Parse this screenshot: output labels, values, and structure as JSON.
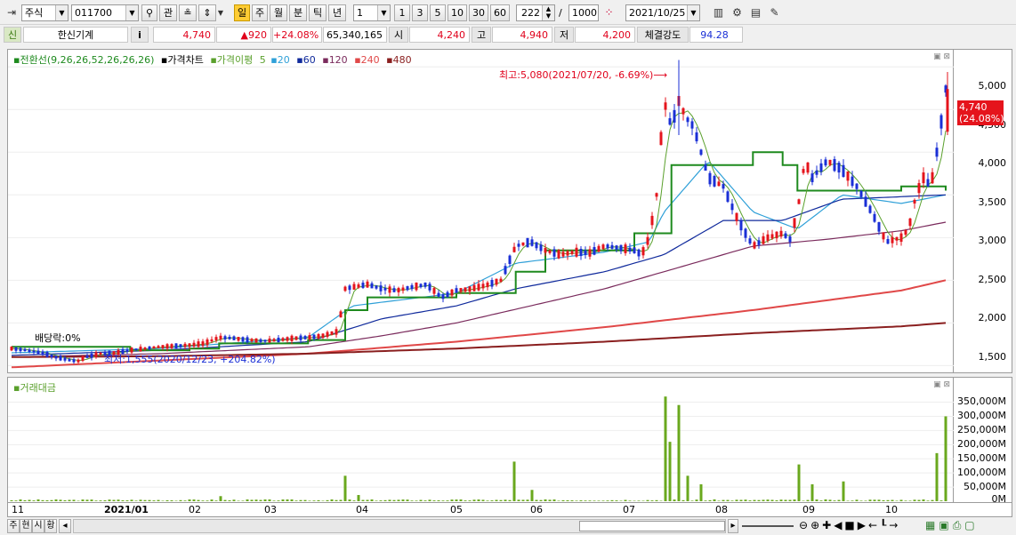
{
  "toolbar": {
    "asset_type": "주식",
    "code": "011700",
    "search_icon": "search-icon",
    "gwan": "관",
    "periods": [
      "일",
      "주",
      "월",
      "분",
      "틱",
      "년"
    ],
    "active_period": "일",
    "interval_select": "1",
    "intervals": [
      "1",
      "3",
      "5",
      "10",
      "30",
      "60"
    ],
    "count": "222",
    "slash": "/",
    "max": "1000",
    "date": "2021/10/25"
  },
  "info": {
    "badge": "신",
    "name": "한신기계",
    "info_btn": "i",
    "price": "4,740",
    "change": "▲920",
    "change_pct": "+24.08%",
    "volume": "65,340,165",
    "open_label": "시",
    "open": "4,240",
    "high_label": "고",
    "high": "4,940",
    "low_label": "저",
    "low": "4,200",
    "strength_label": "체결강도",
    "strength": "94.28"
  },
  "legend": {
    "ichimoku": "전환선(9,26,26,52,26,26,26)",
    "price": "가격차트",
    "ma_label": "가격이평",
    "ma": [
      "5",
      "20",
      "60",
      "120",
      "240",
      "480"
    ]
  },
  "annotations": {
    "high": "최고:5,080(2021/07/20, -6.69%)⟶",
    "low": "최저:1,555(2020/12/23, +204.82%)",
    "dividend": "배당락:0%",
    "last_price": "4,740",
    "last_pct": "(24.08%)"
  },
  "price_axis": [
    "5,000",
    "4,500",
    "4,000",
    "3,500",
    "3,000",
    "2,500",
    "2,000",
    "1,500"
  ],
  "vol_legend": "거래대금",
  "vol_axis": [
    "350,000M",
    "300,000M",
    "250,000M",
    "200,000M",
    "150,000M",
    "100,000M",
    "50,000M",
    "0M"
  ],
  "date_axis": [
    "11",
    "2021/01",
    "02",
    "03",
    "04",
    "05",
    "06",
    "07",
    "08",
    "09",
    "10"
  ],
  "bottom": {
    "tabs": [
      "주",
      "현",
      "시",
      "황"
    ]
  },
  "colors": {
    "up": "#e5141c",
    "down": "#1a2fd6",
    "ma5": "#5aa02c",
    "ma20": "#2fa0d8",
    "ma60": "#102a9c",
    "ma120": "#7a2a5c",
    "ma240": "#e04848",
    "ma480": "#8a1f1f",
    "ichimoku": "#1e8a1e",
    "volume": "#6aa81e"
  },
  "chart_data": {
    "type": "candlestick",
    "ylim": [
      1400,
      5200
    ],
    "x_dates_start": "2020-11",
    "price_path": [
      [
        0,
        1700
      ],
      [
        10,
        1680
      ],
      [
        20,
        1650
      ],
      [
        30,
        1600
      ],
      [
        40,
        1560
      ],
      [
        45,
        1555
      ],
      [
        50,
        1600
      ],
      [
        60,
        1640
      ],
      [
        70,
        1650
      ],
      [
        80,
        1680
      ],
      [
        90,
        1700
      ],
      [
        100,
        1720
      ],
      [
        110,
        1730
      ],
      [
        120,
        1740
      ],
      [
        130,
        1760
      ],
      [
        140,
        1830
      ],
      [
        150,
        1820
      ],
      [
        160,
        1800
      ],
      [
        170,
        1790
      ],
      [
        180,
        1800
      ],
      [
        190,
        1820
      ],
      [
        200,
        1830
      ],
      [
        210,
        1850
      ],
      [
        220,
        1900
      ],
      [
        225,
        2400
      ],
      [
        230,
        2420
      ],
      [
        240,
        2450
      ],
      [
        250,
        2400
      ],
      [
        260,
        2380
      ],
      [
        270,
        2420
      ],
      [
        280,
        2450
      ],
      [
        290,
        2300
      ],
      [
        300,
        2380
      ],
      [
        310,
        2400
      ],
      [
        320,
        2440
      ],
      [
        330,
        2500
      ],
      [
        340,
        2900
      ],
      [
        350,
        2950
      ],
      [
        360,
        2850
      ],
      [
        370,
        2800
      ],
      [
        380,
        2830
      ],
      [
        390,
        2820
      ],
      [
        400,
        2900
      ],
      [
        410,
        2880
      ],
      [
        420,
        2850
      ],
      [
        425,
        2800
      ],
      [
        430,
        3000
      ],
      [
        435,
        3500
      ],
      [
        440,
        4600
      ],
      [
        445,
        4300
      ],
      [
        450,
        4600
      ],
      [
        455,
        4400
      ],
      [
        460,
        4300
      ],
      [
        465,
        4000
      ],
      [
        470,
        3700
      ],
      [
        480,
        3600
      ],
      [
        490,
        3200
      ],
      [
        500,
        2900
      ],
      [
        510,
        3000
      ],
      [
        520,
        3050
      ],
      [
        525,
        2980
      ],
      [
        530,
        3300
      ],
      [
        535,
        3900
      ],
      [
        540,
        3700
      ],
      [
        550,
        3900
      ],
      [
        560,
        3800
      ],
      [
        570,
        3600
      ],
      [
        580,
        3300
      ],
      [
        590,
        2950
      ],
      [
        600,
        3000
      ],
      [
        605,
        3100
      ],
      [
        610,
        3500
      ],
      [
        615,
        3700
      ],
      [
        620,
        3600
      ],
      [
        625,
        4100
      ],
      [
        630,
        4740
      ]
    ],
    "ma_series": {
      "ma20": [
        [
          0,
          1650
        ],
        [
          100,
          1700
        ],
        [
          200,
          1830
        ],
        [
          230,
          2200
        ],
        [
          300,
          2350
        ],
        [
          340,
          2700
        ],
        [
          400,
          2830
        ],
        [
          430,
          2950
        ],
        [
          440,
          3300
        ],
        [
          470,
          3900
        ],
        [
          500,
          3300
        ],
        [
          530,
          3100
        ],
        [
          560,
          3500
        ],
        [
          600,
          3400
        ],
        [
          630,
          3500
        ]
      ],
      "ma60": [
        [
          0,
          1620
        ],
        [
          100,
          1680
        ],
        [
          200,
          1780
        ],
        [
          250,
          2050
        ],
        [
          300,
          2200
        ],
        [
          340,
          2400
        ],
        [
          400,
          2600
        ],
        [
          440,
          2800
        ],
        [
          480,
          3200
        ],
        [
          520,
          3200
        ],
        [
          560,
          3450
        ],
        [
          630,
          3500
        ]
      ],
      "ma120": [
        [
          0,
          1600
        ],
        [
          100,
          1640
        ],
        [
          200,
          1720
        ],
        [
          250,
          1850
        ],
        [
          300,
          2000
        ],
        [
          350,
          2200
        ],
        [
          400,
          2400
        ],
        [
          450,
          2650
        ],
        [
          500,
          2900
        ],
        [
          550,
          2980
        ],
        [
          600,
          3080
        ],
        [
          630,
          3180
        ]
      ],
      "ma240": [
        [
          0,
          1480
        ],
        [
          100,
          1560
        ],
        [
          200,
          1640
        ],
        [
          300,
          1780
        ],
        [
          400,
          1950
        ],
        [
          500,
          2150
        ],
        [
          600,
          2380
        ],
        [
          630,
          2500
        ]
      ],
      "ma480": [
        [
          0,
          1600
        ],
        [
          100,
          1610
        ],
        [
          200,
          1640
        ],
        [
          300,
          1700
        ],
        [
          400,
          1780
        ],
        [
          500,
          1880
        ],
        [
          600,
          1960
        ],
        [
          630,
          2000
        ]
      ]
    },
    "ichimoku_base": [
      [
        0,
        1720
      ],
      [
        50,
        1720
      ],
      [
        80,
        1680
      ],
      [
        120,
        1700
      ],
      [
        140,
        1760
      ],
      [
        200,
        1800
      ],
      [
        225,
        2150
      ],
      [
        240,
        2300
      ],
      [
        280,
        2300
      ],
      [
        300,
        2350
      ],
      [
        340,
        2600
      ],
      [
        360,
        2850
      ],
      [
        400,
        2850
      ],
      [
        420,
        3050
      ],
      [
        430,
        3050
      ],
      [
        440,
        3050
      ],
      [
        445,
        3850
      ],
      [
        480,
        3850
      ],
      [
        500,
        4000
      ],
      [
        520,
        3850
      ],
      [
        530,
        3550
      ],
      [
        560,
        3550
      ],
      [
        600,
        3600
      ],
      [
        630,
        3550
      ]
    ],
    "volume_days": [
      [
        140,
        18000
      ],
      [
        225,
        90000
      ],
      [
        235,
        22000
      ],
      [
        340,
        140000
      ],
      [
        350,
        40000
      ],
      [
        440,
        370000
      ],
      [
        445,
        210000
      ],
      [
        450,
        340000
      ],
      [
        455,
        90000
      ],
      [
        465,
        60000
      ],
      [
        530,
        130000
      ],
      [
        540,
        60000
      ],
      [
        560,
        70000
      ],
      [
        625,
        170000
      ],
      [
        630,
        300000
      ]
    ],
    "volume_ylim": [
      0,
      380000
    ]
  }
}
